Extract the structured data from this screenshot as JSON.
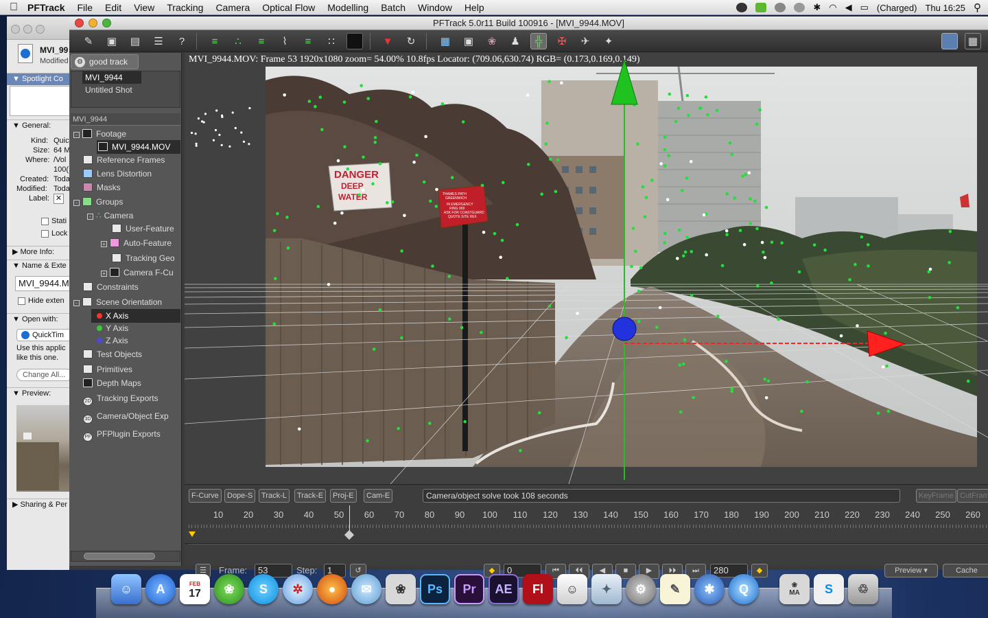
{
  "menubar": {
    "app": "PFTrack",
    "items": [
      "File",
      "Edit",
      "View",
      "Tracking",
      "Camera",
      "Optical Flow",
      "Modelling",
      "Batch",
      "Window",
      "Help"
    ],
    "battery": "(Charged)",
    "clock": "Thu 16:25"
  },
  "finder_info": {
    "filename": "MVI_99",
    "modified": "Modified",
    "spotlight": "Spotlight Co",
    "general": "General:",
    "kind_label": "Kind:",
    "kind_value": "Quic",
    "size_label": "Size:",
    "size_value": "64 M",
    "where_label": "Where:",
    "where_value": "/Vol",
    "where_value2": "100(",
    "created_label": "Created:",
    "created_value": "Toda",
    "modified_label": "Modified:",
    "modified_value": "Toda",
    "label_label": "Label:",
    "stationery": "Stati",
    "locked": "Lock",
    "more_info": "More Info:",
    "name_ext": "Name & Exte",
    "name_value": "MVI_9944.M",
    "hide_ext": "Hide exten",
    "open_with": "Open with:",
    "open_app": "QuickTim",
    "use_app": "Use this applic",
    "use_app2": "like this one.",
    "change_all": "Change All...",
    "preview": "Preview:",
    "sharing": "Sharing & Per"
  },
  "window": {
    "title": "PFTrack 5.0r11 Build 100916 - [MVI_9944.MOV]"
  },
  "tree": {
    "group_tab": "good track",
    "shots": [
      "MVI_9944",
      "Untitled Shot"
    ],
    "header": "MVI_9944",
    "nodes": {
      "footage": "Footage",
      "mov": "MVI_9944.MOV",
      "ref": "Reference Frames",
      "lens": "Lens Distortion",
      "masks": "Masks",
      "groups": "Groups",
      "camera": "Camera",
      "user": "User-Feature",
      "auto": "Auto-Feature",
      "trackgeo": "Tracking Geo",
      "camcu": "Camera F-Cu",
      "constraints": "Constraints",
      "scene": "Scene Orientation",
      "xaxis": "X Axis",
      "yaxis": "Y Axis",
      "zaxis": "Z Axis",
      "test": "Test Objects",
      "prims": "Primitives",
      "depth": "Depth Maps",
      "trackexp": "Tracking Exports",
      "camexp": "Camera/Object Exp",
      "pfplug": "PFPlugin Exports"
    },
    "badges": {
      "track": "2D",
      "cam": "3D",
      "plug": "PF"
    },
    "axis_colors": {
      "x": "#ff3030",
      "y": "#3cc83c",
      "z": "#4a4adc"
    }
  },
  "viewer": {
    "status": "MVI_9944.MOV: Frame 53 1920x1080 zoom= 54.00% 10.8fps Locator: (709.06,630.74) RGB= (0.173,0.169,0.149)",
    "sign1": "DANGER",
    "sign1_b": "DEEP",
    "sign1_c": "WATER",
    "sign2_lines": [
      "THAMES PATH",
      "GREENWICH",
      "IN EMERGENCY",
      "RING 999",
      "ASK FOR COASTGUARD",
      "QUOTE SITE REF."
    ],
    "colors": {
      "tracker": "#22e03a",
      "x_axis": "#ff2020",
      "y_axis": "#1fc21f",
      "origin": "#2233dd"
    }
  },
  "bottom": {
    "tabs": [
      "F-Curve",
      "Dope-S",
      "Track-L",
      "Track-E",
      "Proj-E",
      "Cam-E"
    ],
    "message": "Camera/object solve took 108 seconds",
    "keyframe": "KeyFrame",
    "cutframe": "CutFram",
    "ticks": [
      "10",
      "20",
      "30",
      "40",
      "50",
      "60",
      "70",
      "80",
      "90",
      "100",
      "110",
      "120",
      "130",
      "140",
      "150",
      "160",
      "170",
      "180",
      "190",
      "200",
      "210",
      "220",
      "230",
      "240",
      "250",
      "260"
    ],
    "frame_label": "Frame:",
    "frame_value": "53",
    "step_label": "Step:",
    "step_value": "1",
    "start_value": "0",
    "end_value": "280",
    "preview": "Preview",
    "cache": "Cache"
  },
  "dock": {
    "calendar_month": "FEB",
    "calendar_day": "17",
    "ps": "Ps",
    "pr": "Pr",
    "ae": "AE",
    "fl": "Fl",
    "ma": "MA"
  }
}
